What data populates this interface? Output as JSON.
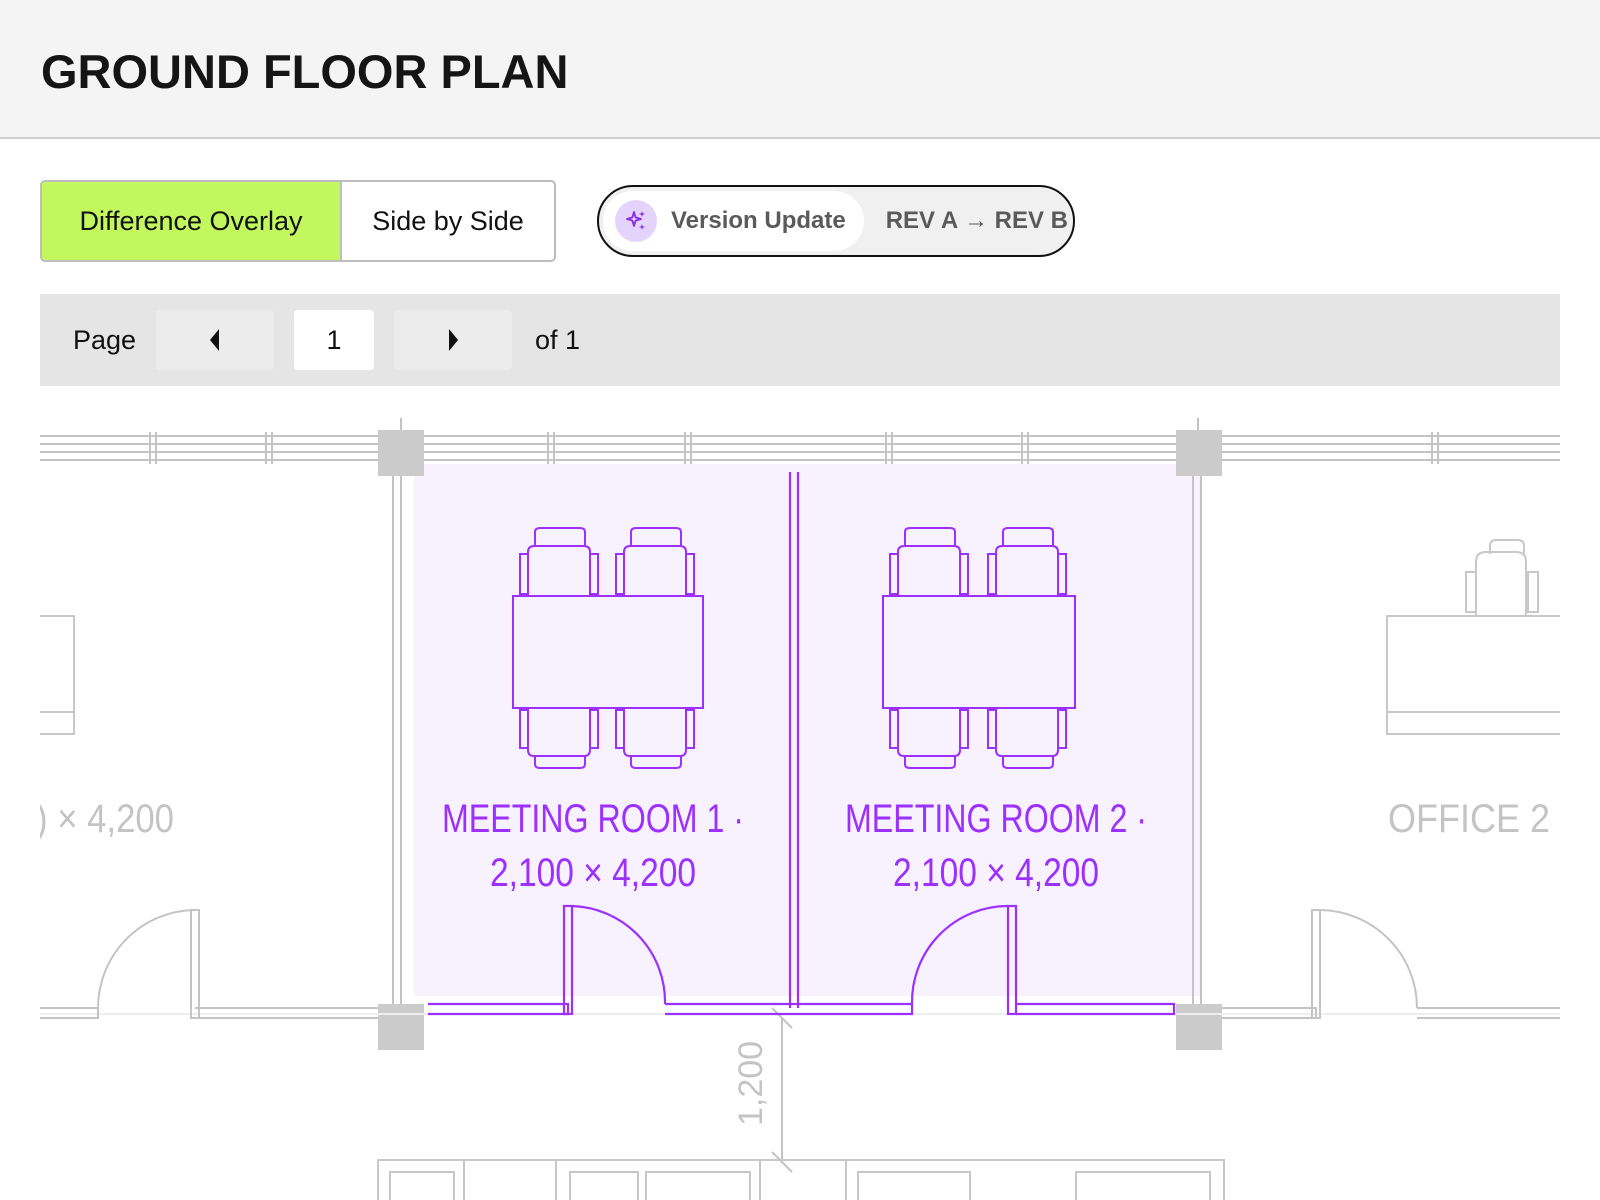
{
  "page": {
    "title": "GROUND FLOOR PLAN"
  },
  "view_toggle": {
    "options": [
      {
        "label": "Difference Overlay",
        "active": true
      },
      {
        "label": "Side by Side",
        "active": false
      }
    ]
  },
  "version_badge": {
    "icon": "sparkle-icon",
    "label": "Version Update",
    "revision": "REV A → REV B"
  },
  "pager": {
    "label": "Page",
    "current_page": "1",
    "total_label": "of 1",
    "prev_icon": "chevron-left-icon",
    "next_icon": "chevron-right-icon"
  },
  "plan": {
    "rooms": {
      "left_partial": {
        "dims": ") × 4,200"
      },
      "meeting_room_1": {
        "name": "MEETING ROOM 1 ·",
        "dims": "2,100 × 4,200"
      },
      "meeting_room_2": {
        "name": "MEETING ROOM 2 ·",
        "dims": "2,100 × 4,200"
      },
      "office_2": {
        "name": "OFFICE 2"
      }
    },
    "corridor_dimension": "1,200",
    "colors": {
      "changed": "#9b30ff",
      "unchanged": "#bdbdbd",
      "highlight": "#f7f0ff",
      "accent": "#c2f75e"
    }
  }
}
